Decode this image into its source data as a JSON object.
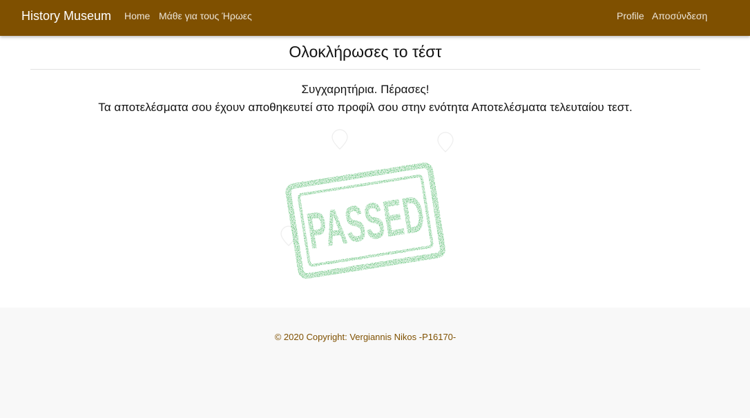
{
  "navbar": {
    "brand": "History Museum",
    "links": [
      "Home",
      "Μάθε για τους Ήρωες"
    ],
    "right_links": [
      "Profile",
      "Αποσύνδεση"
    ],
    "bg_color": "#7f5000"
  },
  "main": {
    "title": "Ολοκλήρωσες το τέστ",
    "message_line1": "Συγχαρητήρια. Πέρασες!",
    "message_line2": "Τα αποτελέσματα σου έχουν αποθηκευτεί στο προφίλ σου στην ενότητα Αποτελέσματα τελευταίου τεστ.",
    "stamp": {
      "text": "PASSED",
      "color": "#1aa33a"
    }
  },
  "footer": {
    "copyright": "© 2020 Copyright: Vergiannis Nikos -P16170-",
    "text_color": "#7f5000"
  }
}
